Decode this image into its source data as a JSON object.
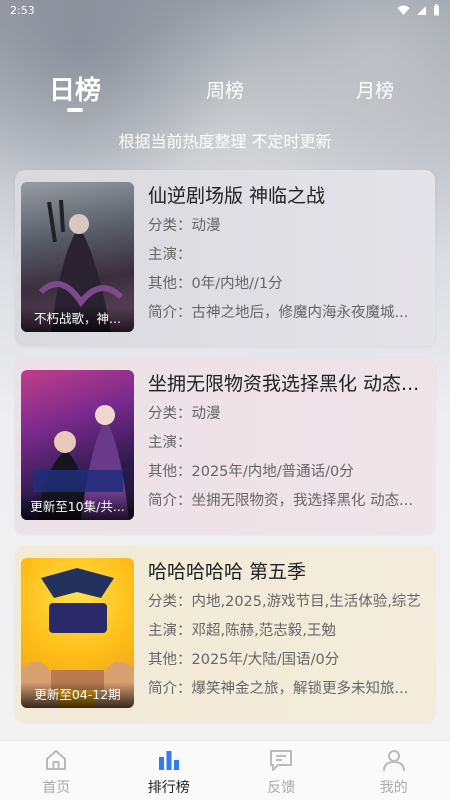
{
  "status_bar": {
    "time": "2:53"
  },
  "tabs": [
    {
      "label": "日榜",
      "active": true
    },
    {
      "label": "周榜",
      "active": false
    },
    {
      "label": "月榜",
      "active": false
    }
  ],
  "subtitle": "根据当前热度整理 不定时更新",
  "items": [
    {
      "title": "仙逆剧场版 神临之战",
      "category": "分类：动漫",
      "cast": "主演：",
      "other": "其他：0年/内地//1分",
      "summary": "简介：古神之地后，修魔内海永夜魔城...",
      "poster_caption": "不朽战歌，神..."
    },
    {
      "title": "坐拥无限物资我选择黑化 动态...",
      "category": "分类：动漫",
      "cast": "主演：",
      "other": "其他：2025年/内地/普通话/0分",
      "summary": "简介：坐拥无限物资，我选择黑化 动态...",
      "poster_caption": "更新至10集/共..."
    },
    {
      "title": "哈哈哈哈哈 第五季",
      "category": "分类：内地,2025,游戏节目,生活体验,综艺",
      "cast": "主演：邓超,陈赫,范志毅,王勉",
      "other": "其他：2025年/大陆/国语/0分",
      "summary": "简介：爆笑神金之旅，解锁更多未知旅...",
      "poster_caption": "更新至04-12期"
    }
  ],
  "tabbar": [
    {
      "label": "首页",
      "icon": "home-icon",
      "active": false
    },
    {
      "label": "排行榜",
      "icon": "ranking-icon",
      "active": true
    },
    {
      "label": "反馈",
      "icon": "feedback-icon",
      "active": false
    },
    {
      "label": "我的",
      "icon": "profile-icon",
      "active": false
    }
  ],
  "colors": {
    "accent": "#2f7cf6",
    "inactive": "#aaaaaa"
  }
}
